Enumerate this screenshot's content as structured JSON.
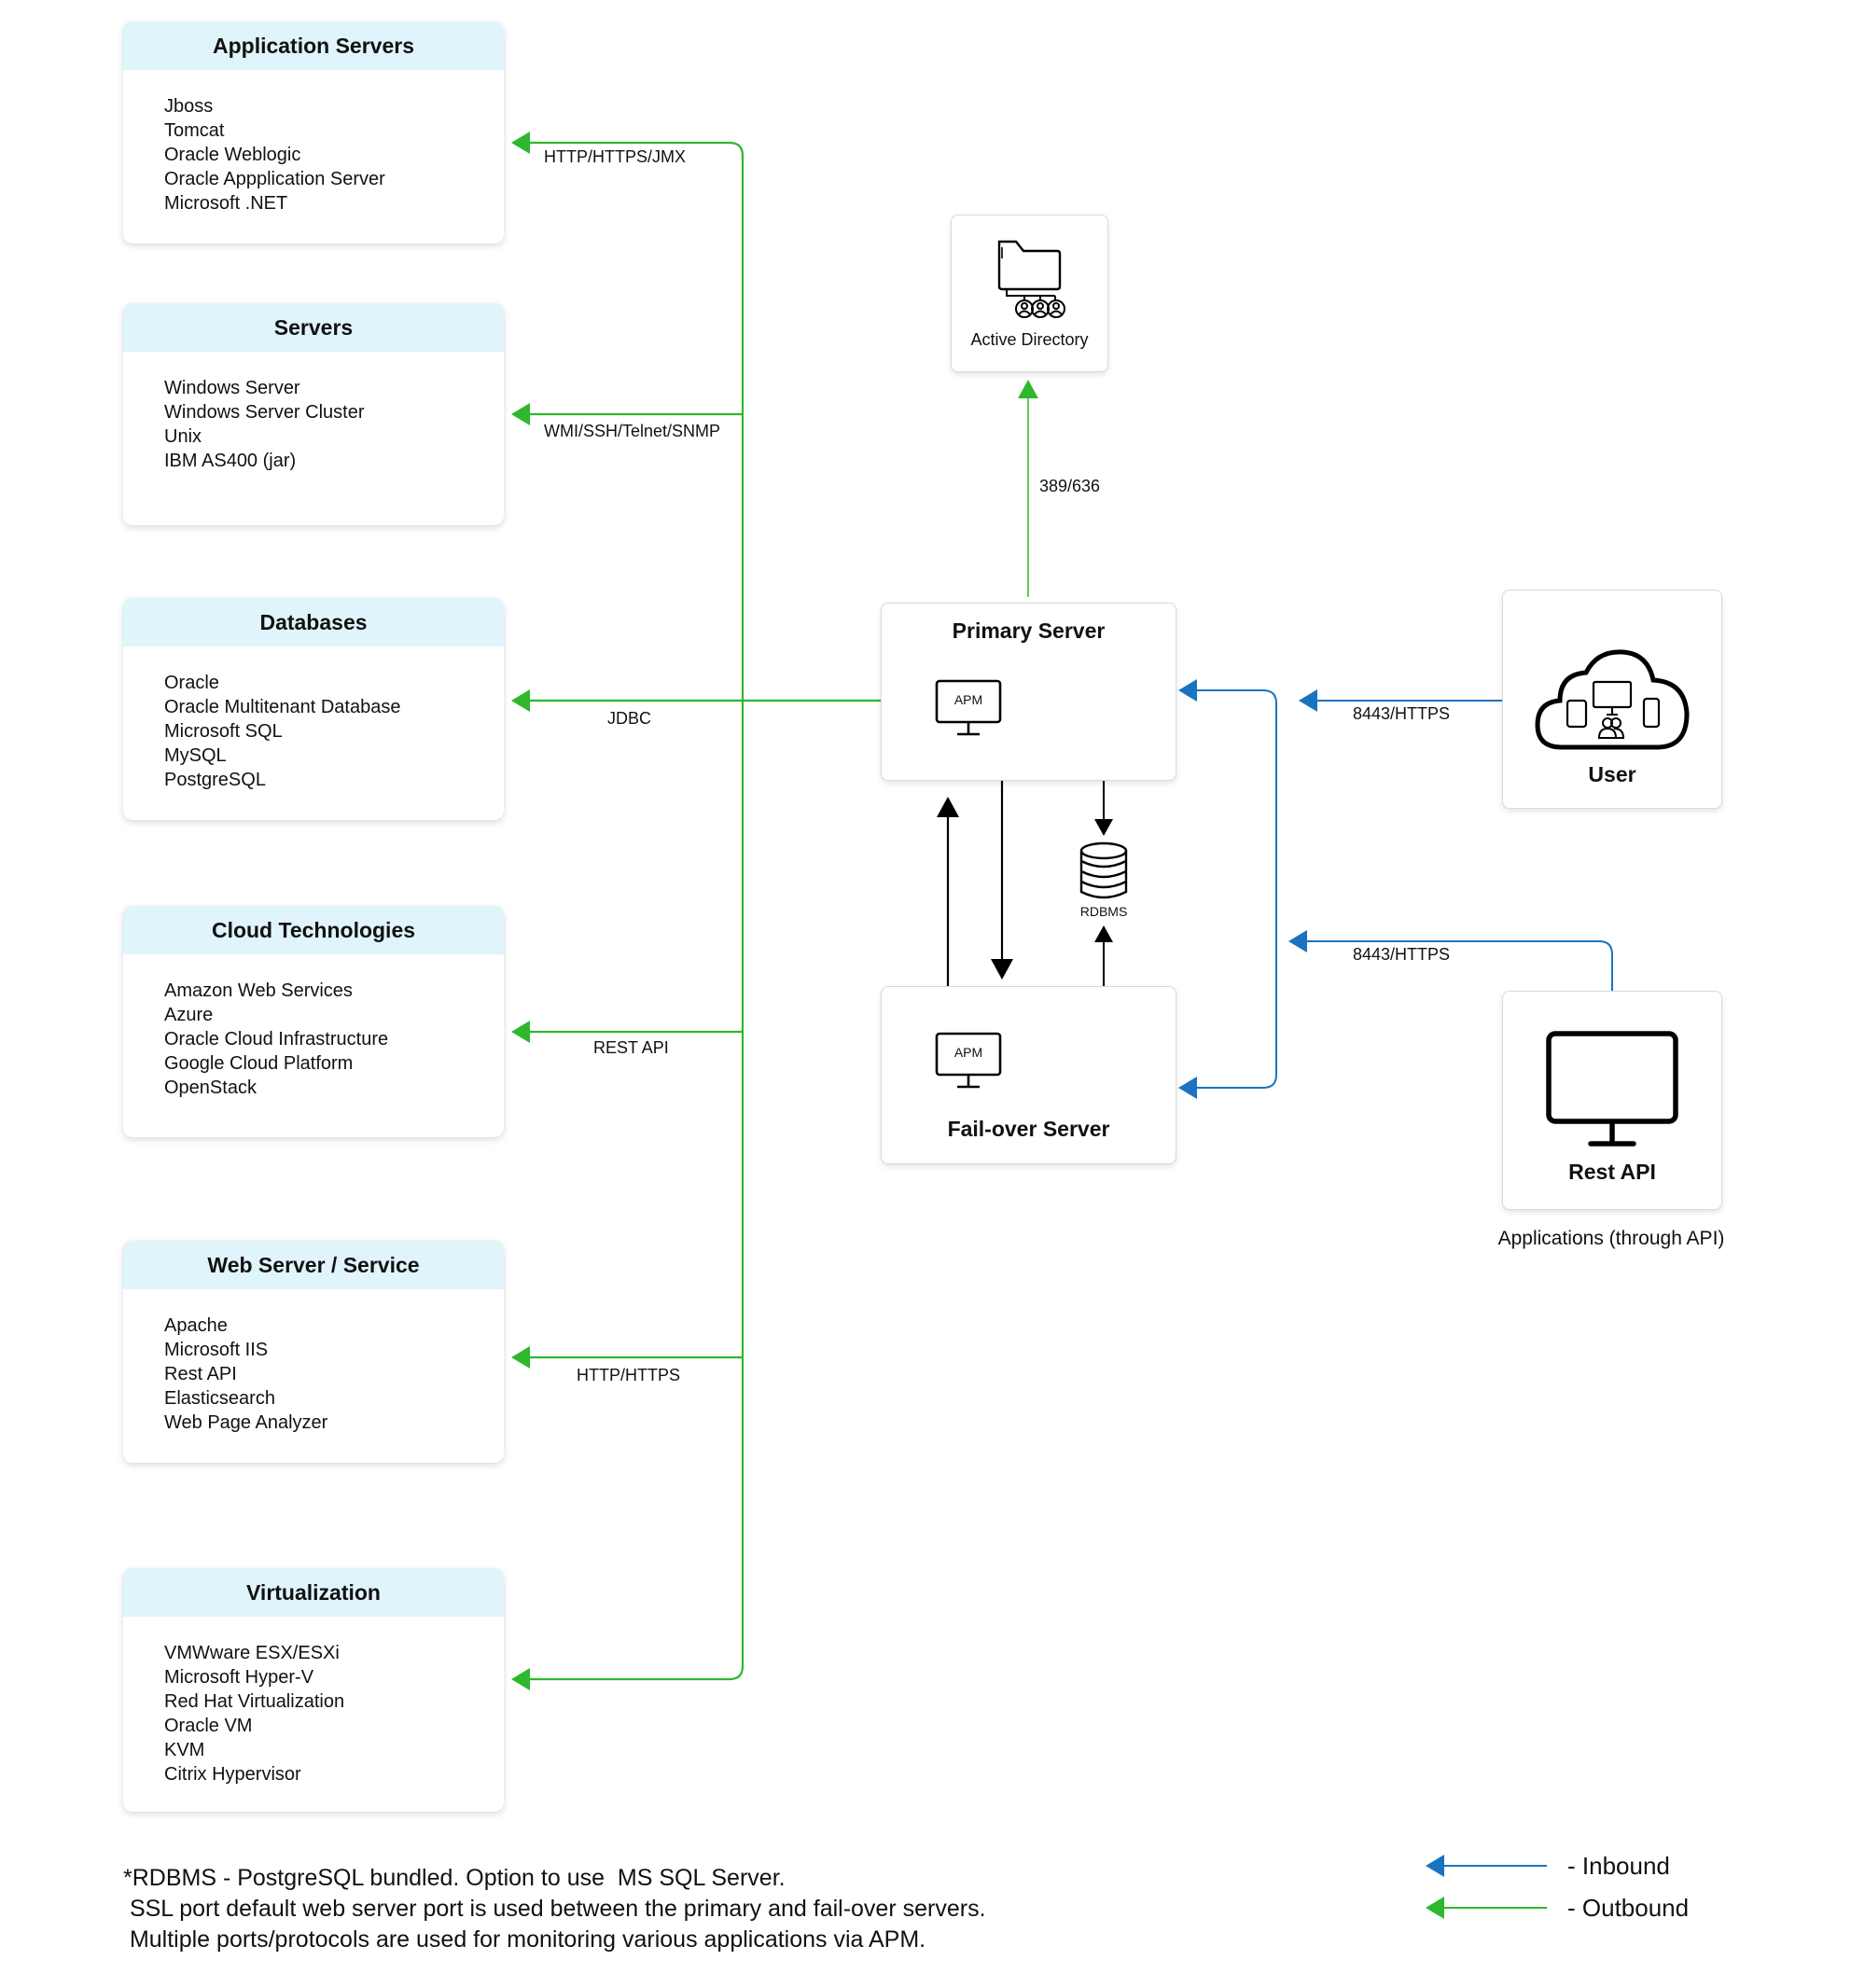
{
  "categories": [
    {
      "title": "Application Servers",
      "protocol": "HTTP/HTTPS/JMX",
      "items": [
        "Jboss",
        "Tomcat",
        "Oracle Weblogic",
        "Oracle Appplication Server",
        "Microsoft .NET"
      ]
    },
    {
      "title": "Servers",
      "protocol": "WMI/SSH/Telnet/SNMP",
      "items": [
        "Windows Server",
        "Windows Server Cluster",
        "Unix",
        "IBM AS400 (jar)"
      ]
    },
    {
      "title": "Databases",
      "protocol": "JDBC",
      "items": [
        "Oracle",
        "Oracle Multitenant Database",
        "Microsoft SQL",
        "MySQL",
        "PostgreSQL"
      ]
    },
    {
      "title": "Cloud Technologies",
      "protocol": "REST API",
      "items": [
        "Amazon Web Services",
        "Azure",
        "Oracle Cloud Infrastructure",
        "Google Cloud Platform",
        "OpenStack"
      ]
    },
    {
      "title": "Web Server / Service",
      "protocol": "HTTP/HTTPS",
      "items": [
        "Apache",
        "Microsoft IIS",
        "Rest API",
        "Elasticsearch",
        "Web Page Analyzer"
      ]
    },
    {
      "title": "Virtualization",
      "protocol": "",
      "items": [
        "VMWware ESX/ESXi",
        "Microsoft Hyper-V",
        "Red Hat Virtualization",
        "Oracle VM",
        "KVM",
        "Citrix Hypervisor"
      ]
    }
  ],
  "active_directory": {
    "label": "Active Directory",
    "icon": "folder-users-icon",
    "protocol": "389/636"
  },
  "primary_server": {
    "title": "Primary Server",
    "apm_label": "APM"
  },
  "failover_server": {
    "title": "Fail-over Server",
    "apm_label": "APM"
  },
  "rdbms": {
    "label": "RDBMS",
    "icon": "database-icon"
  },
  "user": {
    "label": "User",
    "icon": "cloud-devices-icon",
    "protocol": "8443/HTTPS"
  },
  "rest_api": {
    "label": "Rest API",
    "icon": "monitor-icon",
    "protocol": "8443/HTTPS",
    "caption": "Applications (through API)"
  },
  "footnotes": [
    "*RDBMS - PostgreSQL bundled. Option to use  MS SQL Server.",
    " SSL port default web server port is used between the primary and fail-over servers.",
    " Multiple ports/protocols are used for monitoring various applications via APM."
  ],
  "legend": {
    "inbound": {
      "label": "- Inbound",
      "color": "#1a73c0"
    },
    "outbound": {
      "label": "- Outbound",
      "color": "#2db82d"
    }
  },
  "colors": {
    "outbound": "#2db82d",
    "inbound": "#1a73c0",
    "header_bg": "#e0f4fc"
  }
}
